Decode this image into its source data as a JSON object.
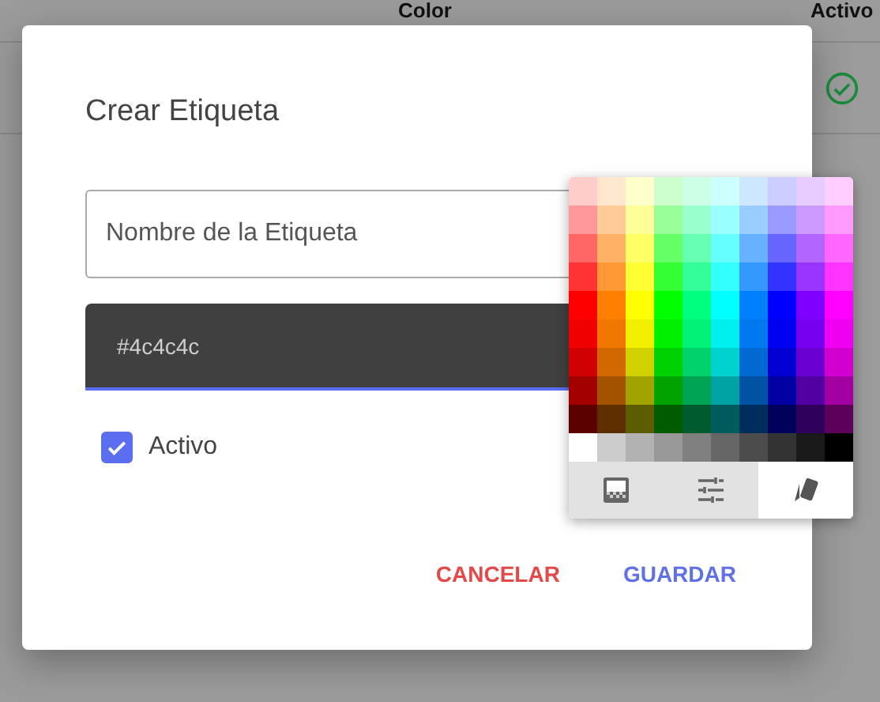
{
  "background_table": {
    "columns": [
      "Color",
      "Activo"
    ],
    "rows": [
      {
        "active": true
      }
    ]
  },
  "dialog": {
    "title": "Crear Etiqueta",
    "name_field": {
      "placeholder": "Nombre de la Etiqueta"
    },
    "color_field": {
      "value": "#4c4c4c"
    },
    "active_checkbox": {
      "label": "Activo",
      "checked": true
    },
    "buttons": [
      {
        "label": "CANCELAR",
        "kind": "cancel"
      },
      {
        "label": "GUARDAR",
        "kind": "save"
      }
    ]
  },
  "palette": {
    "swatches": [
      {
        "color": "#ffcccc"
      },
      {
        "color": "#ffe6cc"
      },
      {
        "color": "#ffffcc"
      },
      {
        "color": "#ccffcc"
      },
      {
        "color": "#ccffe6"
      },
      {
        "color": "#ccffff"
      },
      {
        "color": "#cce6ff"
      },
      {
        "color": "#ccccff"
      },
      {
        "color": "#e6ccff"
      },
      {
        "color": "#ffccff"
      },
      {
        "color": "#ff9999"
      },
      {
        "color": "#ffcc99"
      },
      {
        "color": "#ffff99"
      },
      {
        "color": "#99ff99"
      },
      {
        "color": "#99ffcc"
      },
      {
        "color": "#99ffff"
      },
      {
        "color": "#99ccff"
      },
      {
        "color": "#9999ff"
      },
      {
        "color": "#cc99ff"
      },
      {
        "color": "#ff99ff"
      },
      {
        "color": "#ff6666"
      },
      {
        "color": "#ffb266"
      },
      {
        "color": "#ffff66"
      },
      {
        "color": "#66ff66"
      },
      {
        "color": "#66ffb2"
      },
      {
        "color": "#66ffff"
      },
      {
        "color": "#66b2ff"
      },
      {
        "color": "#6666ff"
      },
      {
        "color": "#b266ff"
      },
      {
        "color": "#ff66ff"
      },
      {
        "color": "#ff3333"
      },
      {
        "color": "#ff9933"
      },
      {
        "color": "#ffff33"
      },
      {
        "color": "#33ff33"
      },
      {
        "color": "#33ff99"
      },
      {
        "color": "#33ffff"
      },
      {
        "color": "#3399ff"
      },
      {
        "color": "#3333ff"
      },
      {
        "color": "#9933ff"
      },
      {
        "color": "#ff33ff"
      },
      {
        "color": "#ff0000"
      },
      {
        "color": "#ff8000"
      },
      {
        "color": "#ffff00"
      },
      {
        "color": "#00ff00"
      },
      {
        "color": "#00ff80"
      },
      {
        "color": "#00ffff"
      },
      {
        "color": "#0080ff"
      },
      {
        "color": "#0000ff"
      },
      {
        "color": "#8000ff"
      },
      {
        "color": "#ff00ff"
      },
      {
        "color": "#f00000"
      },
      {
        "color": "#f07800"
      },
      {
        "color": "#f0f000"
      },
      {
        "color": "#00f000"
      },
      {
        "color": "#00f078"
      },
      {
        "color": "#00f0f0"
      },
      {
        "color": "#0078f0"
      },
      {
        "color": "#0000f0"
      },
      {
        "color": "#7800f0"
      },
      {
        "color": "#f000f0"
      },
      {
        "color": "#d10000"
      },
      {
        "color": "#d16900"
      },
      {
        "color": "#d1d100"
      },
      {
        "color": "#00d100"
      },
      {
        "color": "#00d169"
      },
      {
        "color": "#00d1d1"
      },
      {
        "color": "#0069d1"
      },
      {
        "color": "#0000d1"
      },
      {
        "color": "#6900d1"
      },
      {
        "color": "#d100d1"
      },
      {
        "color": "#a30000"
      },
      {
        "color": "#a35200"
      },
      {
        "color": "#a3a300"
      },
      {
        "color": "#00a300"
      },
      {
        "color": "#00a352"
      },
      {
        "color": "#00a3a3"
      },
      {
        "color": "#0052a3"
      },
      {
        "color": "#0000a3"
      },
      {
        "color": "#5200a3"
      },
      {
        "color": "#a300a3"
      },
      {
        "color": "#5c0000"
      },
      {
        "color": "#5c2e00"
      },
      {
        "color": "#5c5c00"
      },
      {
        "color": "#005c00"
      },
      {
        "color": "#005c2e"
      },
      {
        "color": "#005c5c"
      },
      {
        "color": "#002e5c"
      },
      {
        "color": "#00005c"
      },
      {
        "color": "#2e005c"
      },
      {
        "color": "#5c005c"
      },
      {
        "color": "#ffffff"
      },
      {
        "color": "#cccccc"
      },
      {
        "color": "#b2b2b2"
      },
      {
        "color": "#999999"
      },
      {
        "color": "#808080"
      },
      {
        "color": "#666666"
      },
      {
        "color": "#4c4c4c"
      },
      {
        "color": "#333333"
      },
      {
        "color": "#191919"
      },
      {
        "color": "#000000"
      }
    ],
    "tabs": [
      {
        "kind": "grid",
        "selected": false
      },
      {
        "kind": "sliders",
        "selected": false
      },
      {
        "kind": "swatches",
        "selected": true
      }
    ]
  }
}
